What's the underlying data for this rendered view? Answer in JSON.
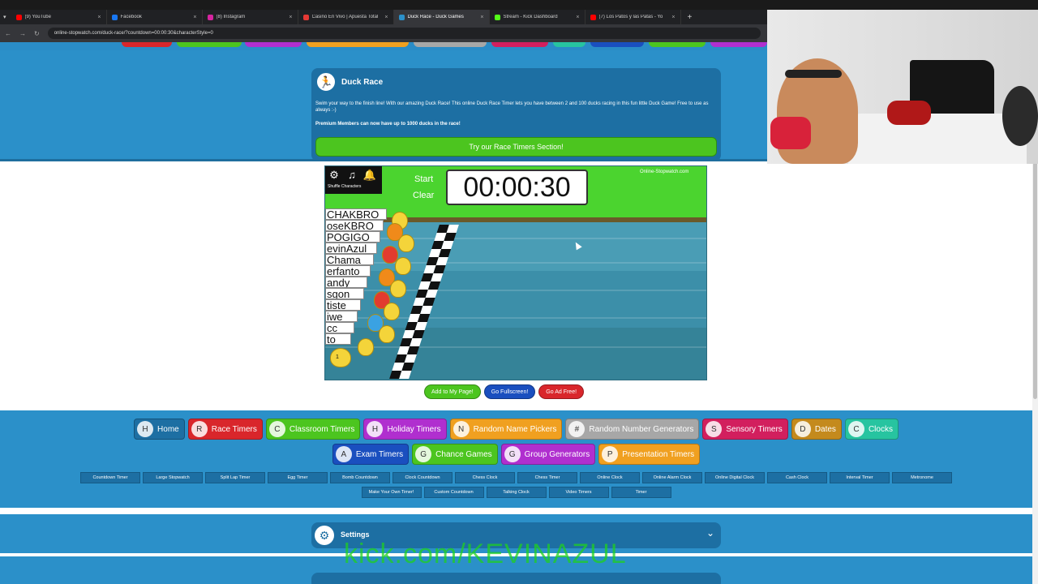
{
  "browser": {
    "tabs": [
      {
        "label": "(9) YouTube",
        "color": "#ff0000"
      },
      {
        "label": "Facebook",
        "color": "#1877f2"
      },
      {
        "label": "(8) Instagram",
        "color": "#d6249f"
      },
      {
        "label": "Casino En Vivo | Apuesta Total",
        "color": "#e53935"
      },
      {
        "label": "Duck Race - Duck Games",
        "color": "#2b90c9"
      },
      {
        "label": "Stream - Kick Dashboard",
        "color": "#53fc18"
      },
      {
        "label": "(7) Los Patos y las Patas - Yo",
        "color": "#ff0000"
      }
    ],
    "url": "online-stopwatch.com/duck-race/?countdown=00:00:30&characterStyle=0"
  },
  "info": {
    "title": "Duck Race",
    "text": "Swim your way to the finish line! With our amazing Duck Race! This online Duck Race Timer lets you have between 2 and 100 ducks racing in this fun little Duck Game! Free to use as always :-)",
    "bold": "Premium Members can now have up to 1000 ducks in the race!",
    "button": "Try our Race Timers Section!"
  },
  "game": {
    "shuffle": "Shuffle Characters",
    "start": "Start",
    "clear": "Clear",
    "timer": "00:00:30",
    "logo": "Online-Stopwatch.com",
    "names": [
      "CHAKBRO",
      "oseKBRO",
      "POGIGO",
      "evinAzul",
      "Chama",
      "erfanto",
      "andy",
      "sgon",
      "tiste",
      "iwe",
      "cc",
      "to"
    ],
    "lane_marker": "1",
    "buttons": [
      {
        "label": "Add to My Page!",
        "color": "#4cc51f"
      },
      {
        "label": "Go Fullscreen!",
        "color": "#1a4fbf"
      },
      {
        "label": "Go Ad Free!",
        "color": "#d9262b"
      }
    ]
  },
  "nav": {
    "row1": [
      {
        "label": "Home",
        "color": "#1d6fa3",
        "icon": "H"
      },
      {
        "label": "Race Timers",
        "color": "#d9262b",
        "icon": "R"
      },
      {
        "label": "Classroom Timers",
        "color": "#4cc51f",
        "icon": "C"
      },
      {
        "label": "Holiday Timers",
        "color": "#b02fcf",
        "icon": "H"
      },
      {
        "label": "Random Name Pickers",
        "color": "#f0a020",
        "icon": "N"
      },
      {
        "label": "Random Number Generators",
        "color": "#a7a7a7",
        "icon": "#"
      },
      {
        "label": "Sensory Timers",
        "color": "#d21f5e",
        "icon": "S"
      },
      {
        "label": "Dates",
        "color": "#c48a1d",
        "icon": "D"
      },
      {
        "label": "Clocks",
        "color": "#27c4a0",
        "icon": "C"
      }
    ],
    "row2": [
      {
        "label": "Exam Timers",
        "color": "#1a4fbf",
        "icon": "A"
      },
      {
        "label": "Chance Games",
        "color": "#4cc51f",
        "icon": "G"
      },
      {
        "label": "Group Generators",
        "color": "#b02fcf",
        "icon": "G"
      },
      {
        "label": "Presentation Timers",
        "color": "#f0a020",
        "icon": "P"
      }
    ],
    "links1": [
      "Countdown Timer",
      "Large Stopwatch",
      "Split Lap Timer",
      "Egg Timer",
      "Bomb Countdown",
      "Clock Countdown",
      "Chess Clock",
      "Chess Timer",
      "Online Clock",
      "Online Alarm Clock",
      "Online Digital Clock",
      "Cash Clock",
      "Interval Timer",
      "Metronome"
    ],
    "links2": [
      "Make Your Own Timer!",
      "Custom Countdown",
      "Talking Clock",
      "Video Timers",
      "Timer"
    ]
  },
  "settings": {
    "title": "Settings"
  },
  "watermark": "kick.com/KEVINAZUL"
}
